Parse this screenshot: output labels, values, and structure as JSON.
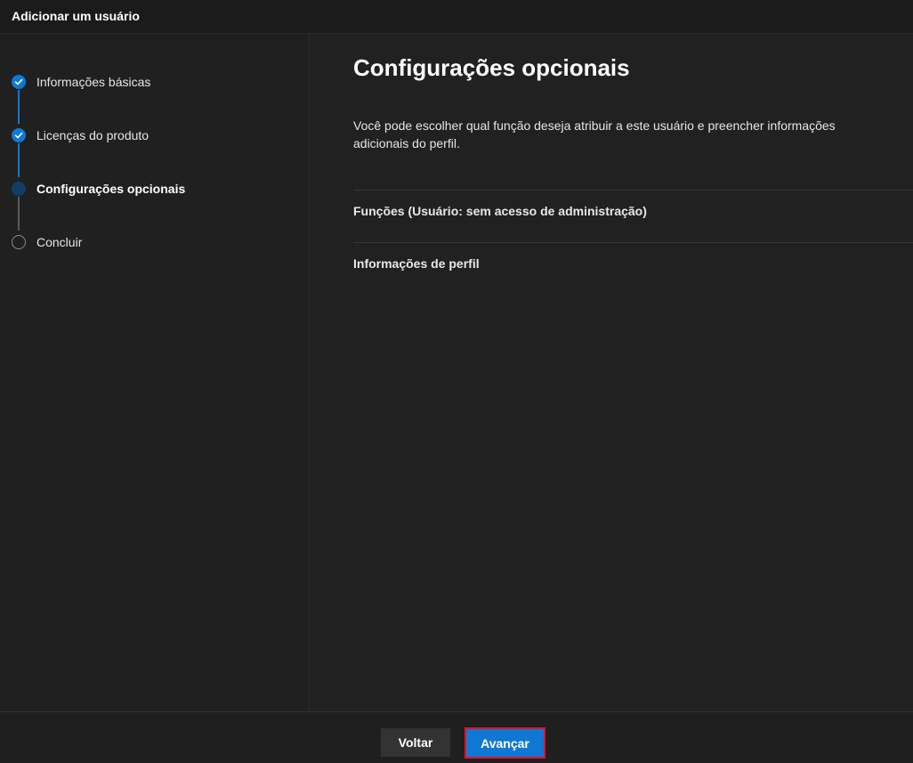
{
  "window": {
    "title": "Adicionar um usuário"
  },
  "steps": [
    {
      "label": "Informações básicas",
      "state": "done"
    },
    {
      "label": "Licenças do produto",
      "state": "done"
    },
    {
      "label": "Configurações opcionais",
      "state": "current"
    },
    {
      "label": "Concluir",
      "state": "pending"
    }
  ],
  "main": {
    "title": "Configurações opcionais",
    "description": "Você pode escolher qual função deseja atribuir a este usuário e preencher informações adicionais do perfil.",
    "sections": [
      {
        "label": "Funções (Usuário: sem acesso de administração)"
      },
      {
        "label": "Informações de perfil"
      }
    ]
  },
  "footer": {
    "back_label": "Voltar",
    "next_label": "Avançar"
  },
  "colors": {
    "accent": "#0f78d4",
    "current_step": "#123e66",
    "highlight_border": "#e81123"
  }
}
